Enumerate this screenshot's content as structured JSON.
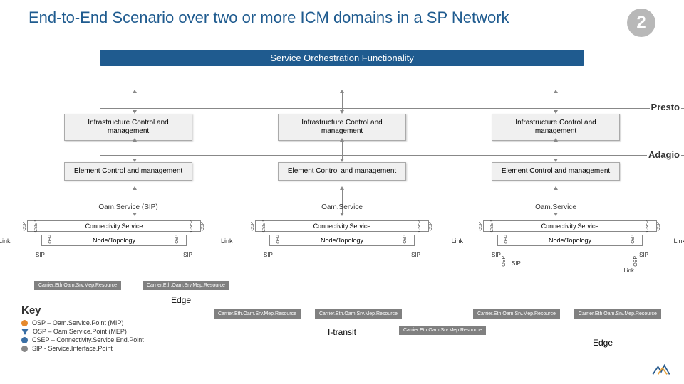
{
  "title": "End-to-End Scenario over two or more ICM domains in a SP Network",
  "badge": "2",
  "sof": "Service Orchestration Functionality",
  "labels": {
    "presto": "Presto",
    "adagio": "Adagio",
    "icm": "Infrastructure Control and management",
    "ecm": "Element Control and management",
    "oam_sip": "Oam.Service (SIP)",
    "oam": "Oam.Service",
    "conn": "Connectivity.Service",
    "node": "Node/Topology",
    "csep": "CSEP",
    "osp": "OSP",
    "sip": "SIP",
    "link": "Link",
    "mep": "Carrier.Eth.Oam.Srv.Mep.Resource",
    "edge": "Edge",
    "itransit": "I-transit"
  },
  "key": {
    "title": "Key",
    "items": [
      "OSP – Oam.Service.Point (MIP)",
      "OSP – Oam.Service.Point (MEP)",
      "CSEP – Connectivity.Service.End.Point",
      "SIP - Service.Interface.Point"
    ]
  },
  "colors": {
    "title": "#1f5b8f",
    "badge": "#b8b8b8",
    "mep": "#808080",
    "orange": "#e68a2e",
    "blue": "#3a6fa5"
  }
}
